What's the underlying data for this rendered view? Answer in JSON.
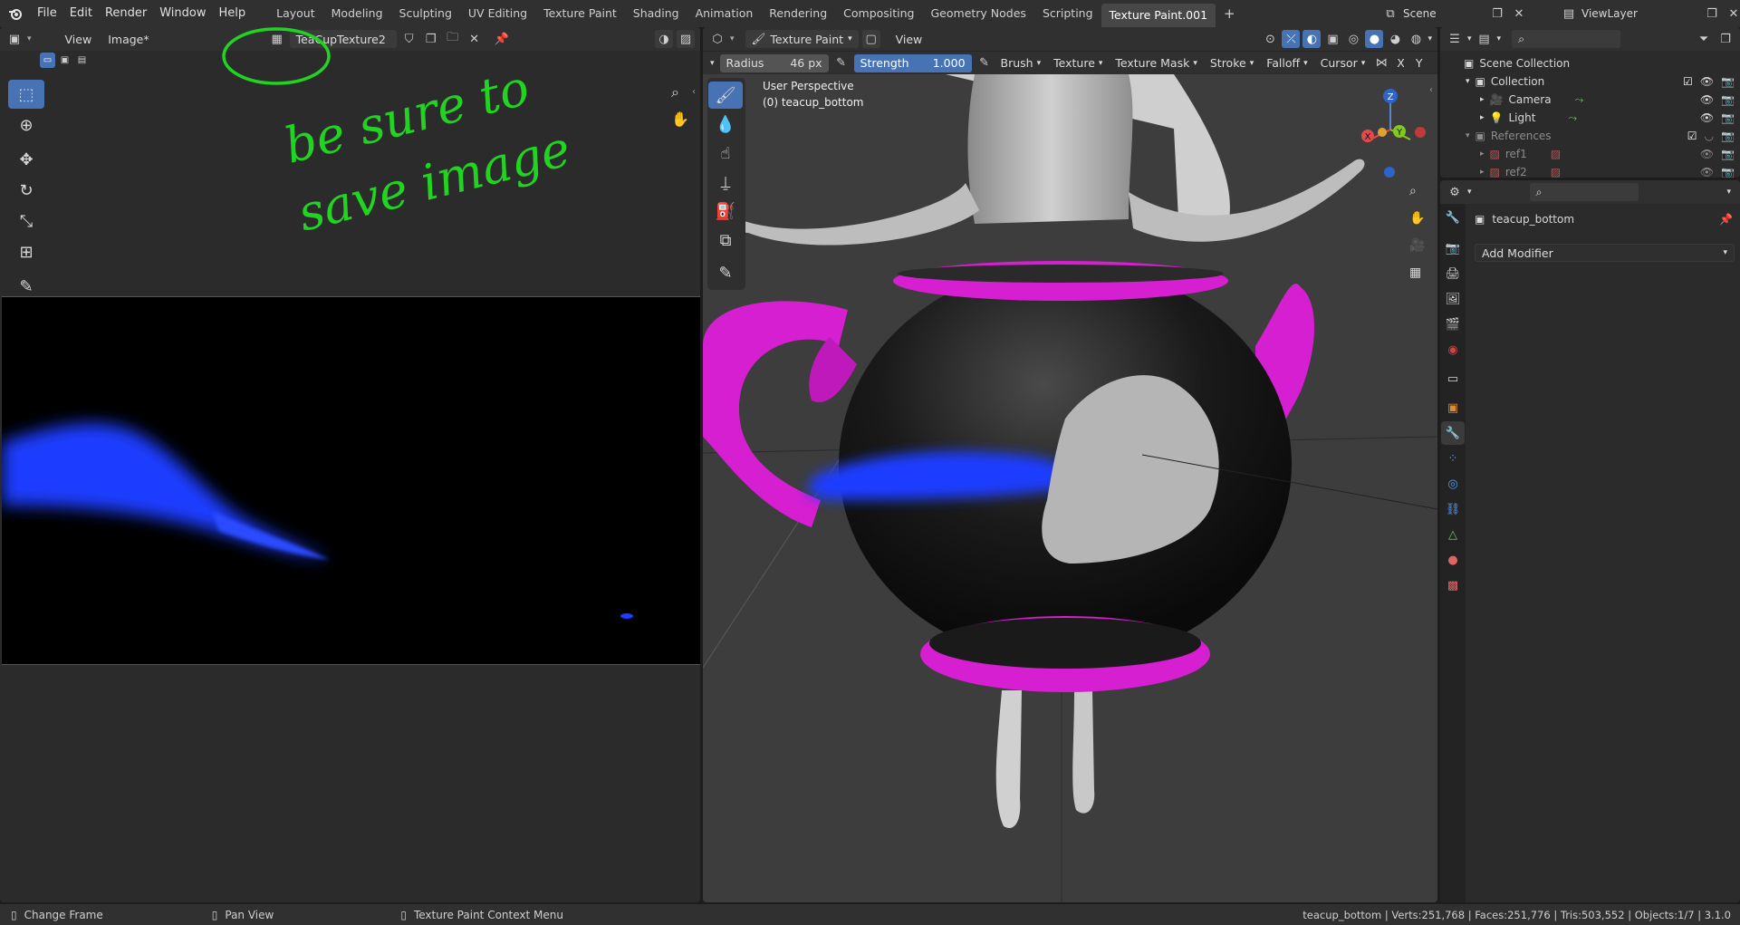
{
  "menubar": {
    "items": [
      "File",
      "Edit",
      "Render",
      "Window",
      "Help"
    ],
    "workspaces": [
      "Layout",
      "Modeling",
      "Sculpting",
      "UV Editing",
      "Texture Paint",
      "Shading",
      "Animation",
      "Rendering",
      "Compositing",
      "Geometry Nodes",
      "Scripting",
      "Texture Paint.001"
    ],
    "add_tab": "+",
    "scene_label": "Scene",
    "viewlayer_label": "ViewLayer"
  },
  "image_editor": {
    "menu_view": "View",
    "menu_image": "Image*",
    "image_name": "TeaCupTexture2",
    "annotation_lines": [
      "be sure to",
      "save image"
    ],
    "annotation_color": "#22d422",
    "stroke_color": "#1a3cff"
  },
  "viewport": {
    "mode_label": "Texture Paint",
    "menu_view": "View",
    "radius_label": "Radius",
    "radius_value": "46 px",
    "strength_label": "Strength",
    "strength_value": "1.000",
    "dropdowns": [
      "Brush",
      "Texture",
      "Texture Mask",
      "Stroke",
      "Falloff",
      "Cursor"
    ],
    "axis_x": "X",
    "axis_y": "Y",
    "perspective_label": "User Perspective",
    "object_label": "(0) teacup_bottom",
    "gizmo_z": "Z",
    "gizmo_y": "Y",
    "gizmo_x": "X",
    "accent_magenta": "#d61fd0"
  },
  "outliner": {
    "scene_collection": "Scene Collection",
    "collection": "Collection",
    "camera": "Camera",
    "light": "Light",
    "references": "References",
    "ref1": "ref1",
    "ref2": "ref2"
  },
  "properties": {
    "object_name": "teacup_bottom",
    "add_modifier": "Add Modifier"
  },
  "statusbar": {
    "change_frame": "Change Frame",
    "pan_view": "Pan View",
    "context_menu": "Texture Paint Context Menu",
    "stats": "teacup_bottom | Verts:251,768 | Faces:251,776 | Tris:503,552 | Objects:1/7 | 3.1.0"
  }
}
